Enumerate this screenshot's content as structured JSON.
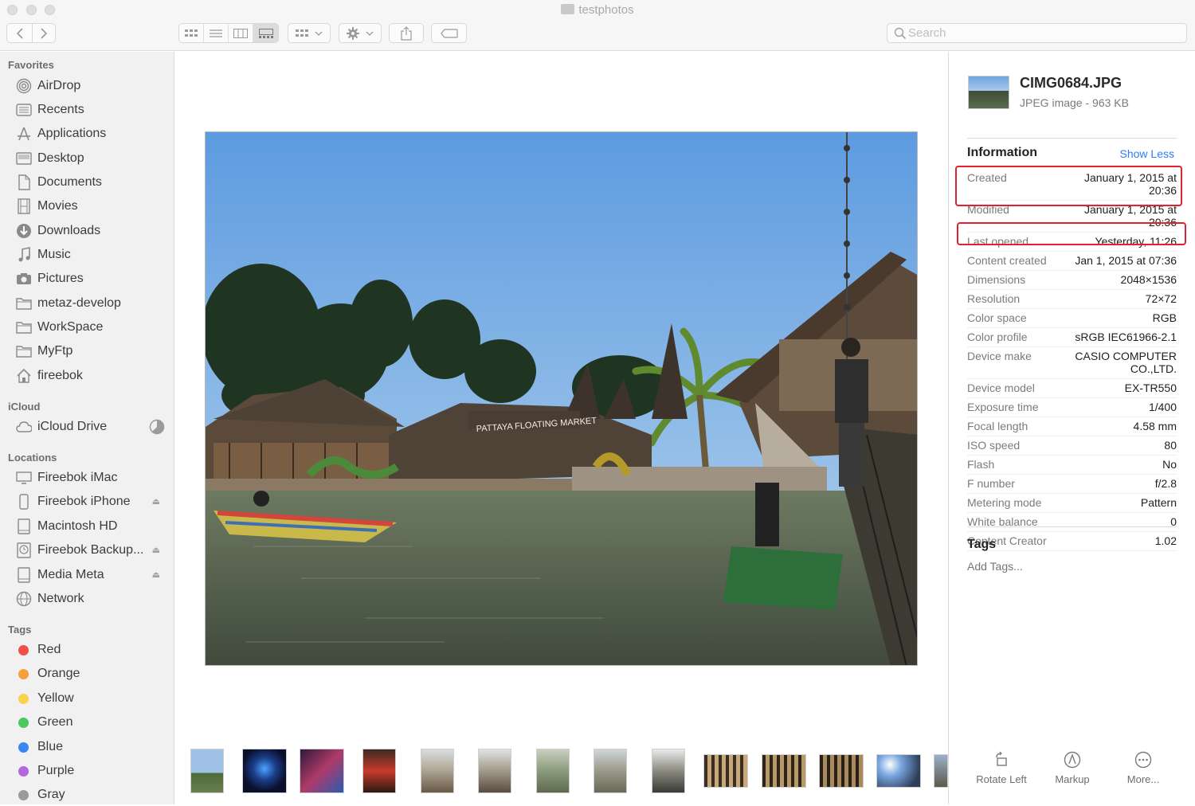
{
  "window": {
    "title": "testphotos"
  },
  "toolbar": {
    "search_placeholder": "Search",
    "buttons": [
      {
        "name": "back",
        "icon": "chevron-left-icon"
      },
      {
        "name": "forward",
        "icon": "chevron-right-icon"
      },
      {
        "name": "view-icon",
        "icon": "grid-icon"
      },
      {
        "name": "view-list",
        "icon": "list-icon"
      },
      {
        "name": "view-columns",
        "icon": "columns-icon"
      },
      {
        "name": "view-gallery",
        "icon": "gallery-icon"
      },
      {
        "name": "group",
        "icon": "group-icon"
      },
      {
        "name": "action",
        "icon": "gear-icon"
      },
      {
        "name": "share",
        "icon": "share-icon"
      },
      {
        "name": "tag",
        "icon": "tag-icon"
      }
    ]
  },
  "sidebar": {
    "favorites_label": "Favorites",
    "favorites": [
      {
        "label": "AirDrop",
        "icon": "airdrop-icon"
      },
      {
        "label": "Recents",
        "icon": "clock-icon"
      },
      {
        "label": "Applications",
        "icon": "applications-icon"
      },
      {
        "label": "Desktop",
        "icon": "desktop-icon"
      },
      {
        "label": "Documents",
        "icon": "document-icon"
      },
      {
        "label": "Movies",
        "icon": "film-icon"
      },
      {
        "label": "Downloads",
        "icon": "download-icon"
      },
      {
        "label": "Music",
        "icon": "music-icon"
      },
      {
        "label": "Pictures",
        "icon": "camera-icon"
      },
      {
        "label": "metaz-develop",
        "icon": "folder-icon"
      },
      {
        "label": "WorkSpace",
        "icon": "folder-icon"
      },
      {
        "label": "MyFtp",
        "icon": "folder-icon"
      },
      {
        "label": "fireebok",
        "icon": "home-icon"
      }
    ],
    "icloud_label": "iCloud",
    "icloud": [
      {
        "label": "iCloud Drive",
        "icon": "cloud-icon"
      }
    ],
    "locations_label": "Locations",
    "locations": [
      {
        "label": "Fireebok iMac",
        "icon": "imac-icon"
      },
      {
        "label": "Fireebok iPhone",
        "icon": "iphone-icon"
      },
      {
        "label": "Macintosh HD",
        "icon": "drive-icon"
      },
      {
        "label": "Fireebok Backup...",
        "icon": "timemachine-icon"
      },
      {
        "label": "Media Meta",
        "icon": "drive-icon"
      },
      {
        "label": "Network",
        "icon": "globe-icon"
      }
    ],
    "tags_label": "Tags",
    "tags": [
      {
        "label": "Red",
        "color": "#f0504a"
      },
      {
        "label": "Orange",
        "color": "#f5a03a"
      },
      {
        "label": "Yellow",
        "color": "#f7d24a"
      },
      {
        "label": "Green",
        "color": "#4bc85e"
      },
      {
        "label": "Blue",
        "color": "#3a87f0"
      },
      {
        "label": "Purple",
        "color": "#b466dc"
      },
      {
        "label": "Gray",
        "color": "#9b9b9b"
      }
    ]
  },
  "preview": {
    "photo_sign_text": "PATTAYA FLOATING MARKET",
    "thumbnails_count": 14
  },
  "info": {
    "file_name": "CIMG0684.JPG",
    "file_sub": "JPEG image - 963 KB",
    "section_title": "Information",
    "toggle_label": "Show Less",
    "rows": [
      {
        "k": "Created",
        "v": "January 1, 2015 at 20:36"
      },
      {
        "k": "Modified",
        "v": "January 1, 2015 at 20:36"
      },
      {
        "k": "Last opened",
        "v": "Yesterday, 11:26"
      },
      {
        "k": "Content created",
        "v": "Jan 1, 2015 at 07:36"
      },
      {
        "k": "Dimensions",
        "v": "2048×1536"
      },
      {
        "k": "Resolution",
        "v": "72×72"
      },
      {
        "k": "Color space",
        "v": "RGB"
      },
      {
        "k": "Color profile",
        "v": "sRGB IEC61966-2.1"
      },
      {
        "k": "Device make",
        "v": "CASIO COMPUTER CO.,LTD."
      },
      {
        "k": "Device model",
        "v": "EX-TR550"
      },
      {
        "k": "Exposure time",
        "v": "1/400"
      },
      {
        "k": "Focal length",
        "v": "4.58 mm"
      },
      {
        "k": "ISO speed",
        "v": "80"
      },
      {
        "k": "Flash",
        "v": "No"
      },
      {
        "k": "F number",
        "v": "f/2.8"
      },
      {
        "k": "Metering mode",
        "v": "Pattern"
      },
      {
        "k": "White balance",
        "v": "0"
      },
      {
        "k": "Content Creator",
        "v": "1.02"
      }
    ],
    "tags_title": "Tags",
    "add_tags_placeholder": "Add Tags...",
    "actions": [
      {
        "label": "Rotate Left",
        "icon": "rotate-left-icon"
      },
      {
        "label": "Markup",
        "icon": "markup-icon"
      },
      {
        "label": "More...",
        "icon": "more-icon"
      }
    ],
    "highlight_color": "#e0212e"
  }
}
